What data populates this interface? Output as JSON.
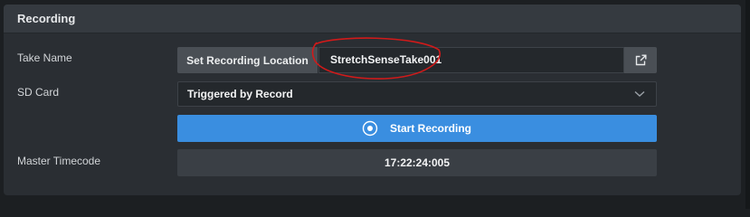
{
  "panel": {
    "title": "Recording"
  },
  "take": {
    "label": "Take Name",
    "set_location_label": "Set Recording Location",
    "value": "StretchSenseTake001",
    "open_icon": "external-link-icon"
  },
  "sd_card": {
    "label": "SD Card",
    "selected": "Triggered by Record",
    "chevron_icon": "chevron-down-icon"
  },
  "record": {
    "label": "Start Recording",
    "icon": "record-icon"
  },
  "timecode": {
    "label": "Master Timecode",
    "value": "17:22:24:005"
  },
  "colors": {
    "accent": "#3a8ee0",
    "annotation": "#d11a1a"
  }
}
